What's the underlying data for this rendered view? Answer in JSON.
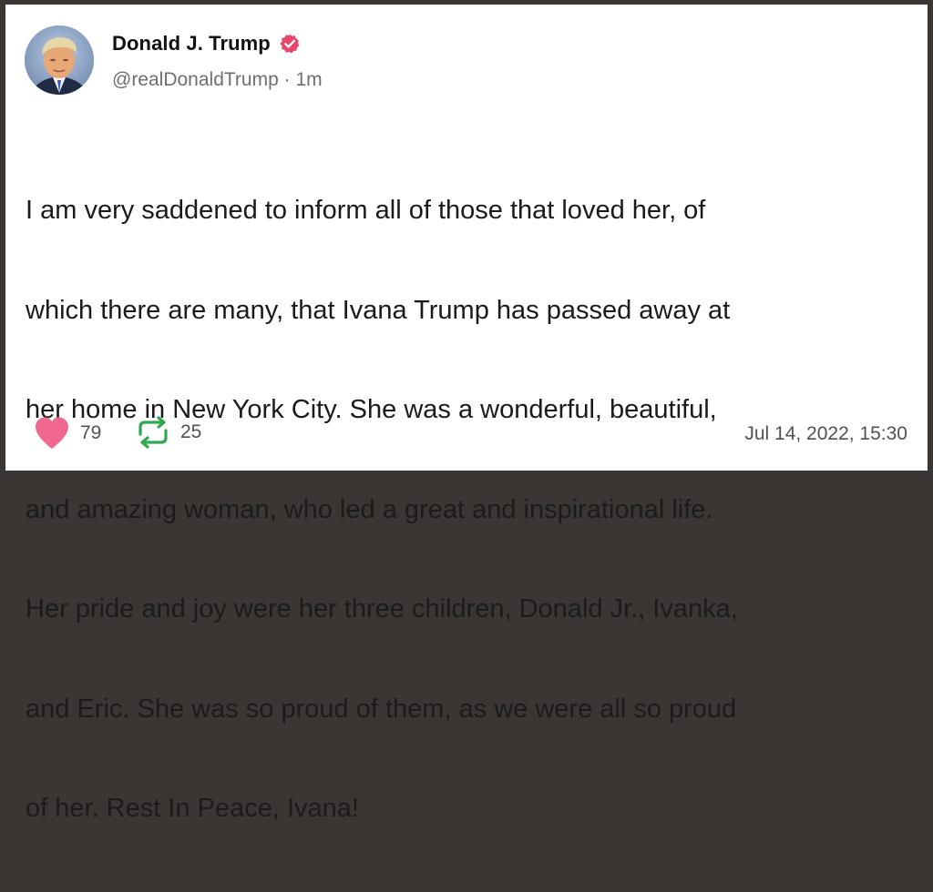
{
  "post": {
    "author": {
      "display_name": "Donald J. Trump",
      "handle": "@realDonaldTrump",
      "separator": " · ",
      "relative_time": "1m",
      "avatar_icon": "profile-photo",
      "verified_icon": "verified-badge-icon"
    },
    "text_lines": [
      "I am very saddened to inform all of those that loved her, of",
      "which there are many, that Ivana Trump has passed away at",
      "her home in New York City. She was a wonderful, beautiful,",
      "and amazing woman, who led a great and inspirational life.",
      "Her pride and joy were her three children, Donald Jr., Ivanka,",
      "and Eric. She was so proud of them, as we were all so proud",
      "of her. Rest In Peace, Ivana!"
    ],
    "stats": {
      "likes": "79",
      "reposts": "25",
      "like_icon": "heart-icon",
      "repost_icon": "repost-icon"
    },
    "timestamp": "Jul 14, 2022, 15:30"
  },
  "colors": {
    "verified": "#e8476a",
    "heart": "#f06890",
    "repost": "#2fa84f",
    "text": "#1b1b1b",
    "muted": "#6e6e73"
  }
}
